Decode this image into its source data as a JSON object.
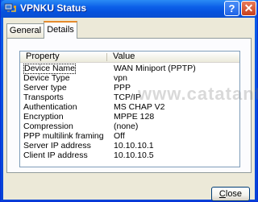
{
  "window": {
    "title": "VPNKU Status",
    "help_label": "?",
    "close_glyph": "✕",
    "title_icon": "network-connection-icon"
  },
  "tabs": [
    {
      "label": "General",
      "selected": false
    },
    {
      "label": "Details",
      "selected": true
    }
  ],
  "details": {
    "columns": [
      "Property",
      "Value"
    ],
    "rows": [
      {
        "property": "Device Name",
        "value": "WAN Miniport (PPTP)"
      },
      {
        "property": "Device Type",
        "value": "vpn"
      },
      {
        "property": "Server type",
        "value": "PPP"
      },
      {
        "property": "Transports",
        "value": "TCP/IP"
      },
      {
        "property": "Authentication",
        "value": "MS CHAP V2"
      },
      {
        "property": "Encryption",
        "value": "MPPE 128"
      },
      {
        "property": "Compression",
        "value": "(none)"
      },
      {
        "property": "PPP multilink framing",
        "value": "Off"
      },
      {
        "property": "Server IP address",
        "value": "10.10.10.1"
      },
      {
        "property": "Client IP address",
        "value": "10.10.10.5"
      }
    ]
  },
  "watermark": "www.catatanteknisi.com",
  "buttons": {
    "close_mnemonic": "C",
    "close_rest": "lose"
  },
  "colors": {
    "titlebar": "#0c5fe8",
    "tab_highlight": "#e68b2c",
    "dialog_face": "#ece9d8"
  }
}
